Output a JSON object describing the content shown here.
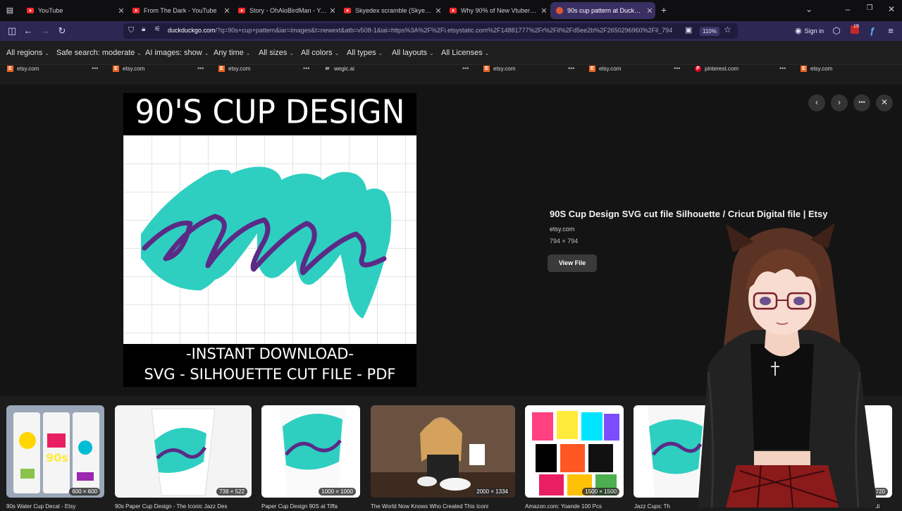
{
  "tabs": [
    {
      "title": "YouTube",
      "icon": "youtube-icon"
    },
    {
      "title": "From The Dark - YouTube",
      "icon": "youtube-icon"
    },
    {
      "title": "Story - OhAloBirdMan - YouTub",
      "icon": "youtube-icon"
    },
    {
      "title": "Skyedex scramble (Skyebrows C",
      "icon": "youtube-icon"
    },
    {
      "title": "Why 90% of New Vtubers FAIL",
      "icon": "youtube-icon"
    },
    {
      "title": "90s cup pattern at DuckDuckGo",
      "icon": "duckduckgo-icon",
      "active": true
    }
  ],
  "toolbar": {
    "url_domain": "duckduckgo.com",
    "url_rest": "/?q=90s+cup+pattern&iar=images&t=newext&atb=v508-1&iai=https%3A%2F%2Fi.etsystatic.com%2F14881777%2Fr%2Fil%2Fd5ee2b%2F2650296960%2Fil_794",
    "zoom": "110%",
    "signin": "Sign in",
    "badge": "19"
  },
  "filters": [
    "All regions",
    "Safe search: moderate",
    "AI images: show",
    "Any time",
    "All sizes",
    "All colors",
    "All types",
    "All layouts",
    "All Licenses"
  ],
  "sources": [
    {
      "name": "etsy.com",
      "icon": "etsy-icon"
    },
    {
      "name": "etsy.com",
      "icon": "etsy-icon"
    },
    {
      "name": "etsy.com",
      "icon": "etsy-icon"
    },
    {
      "name": "wegic.ai",
      "icon": "wegic-icon"
    },
    {
      "name": "etsy.com",
      "icon": "etsy-icon"
    },
    {
      "name": "etsy.com",
      "icon": "etsy-icon"
    },
    {
      "name": "pinterest.com",
      "icon": "pinterest-icon"
    },
    {
      "name": "etsy.com",
      "icon": "etsy-icon"
    }
  ],
  "preview": {
    "image_heading": "90'S CUP DESIGN",
    "image_footer_1": "-INSTANT DOWNLOAD-",
    "image_footer_2": "SVG - SILHOUETTE CUT FILE - PDF",
    "title": "90S Cup Design SVG cut file Silhouette / Cricut Digital file | Etsy",
    "domain": "etsy.com",
    "dims": "794 × 794",
    "view_file": "View File"
  },
  "colors": {
    "accent": "#2d2754",
    "teal": "#2ecfc0",
    "purple": "#5b2a86"
  },
  "thumbs": [
    {
      "dims": "600 × 600",
      "label": "90s Water Cup Decal - Etsy"
    },
    {
      "dims": "738 × 522",
      "label": "90s Paper Cup Design - The Iconic Jazz Des"
    },
    {
      "dims": "1000 × 1000",
      "label": "Paper Cup Design 90S at Tiffa"
    },
    {
      "dims": "2000 × 1334",
      "label": "The World Now Knows Who Created This Iconi"
    },
    {
      "dims": "1500 × 1500",
      "label": "Amazon.com: Yoande 100 Pcs"
    },
    {
      "dims": "",
      "label": "Jazz Cups: Th"
    },
    {
      "dims": "720",
      "label": "di"
    }
  ]
}
